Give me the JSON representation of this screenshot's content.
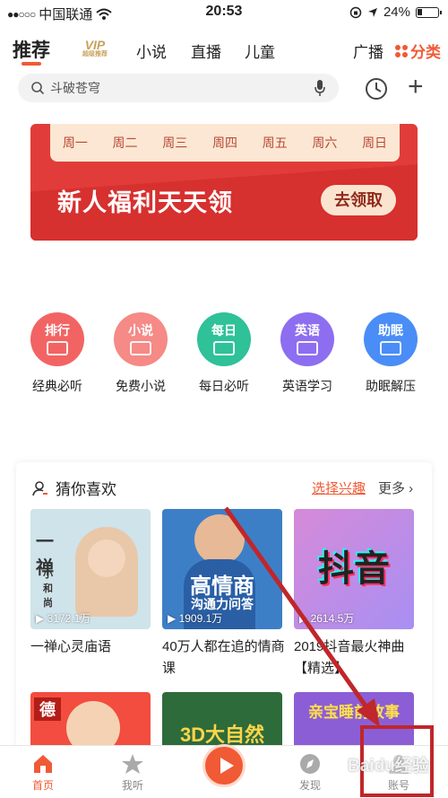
{
  "status_bar": {
    "carrier": "中国联通",
    "time": "20:53",
    "battery": "24%"
  },
  "nav": {
    "tabs": [
      "推荐",
      "小说",
      "直播",
      "儿童",
      "广播"
    ],
    "vip_label": "VIP",
    "vip_sub": "超级推荐",
    "category_label": "分类"
  },
  "search": {
    "placeholder": "斗破苍穹"
  },
  "banner": {
    "weekdays": [
      "周一",
      "周二",
      "周三",
      "周四",
      "周五",
      "周六",
      "周日"
    ],
    "title": "新人福利天天领",
    "button": "去领取"
  },
  "categories": [
    {
      "icon_text": "排行",
      "label": "经典必听",
      "color": "#f26463",
      "icon": "ranking-icon"
    },
    {
      "icon_text": "小说",
      "label": "免费小说",
      "color": "#f58a87",
      "icon": "novel-icon"
    },
    {
      "icon_text": "每日",
      "label": "每日必听",
      "color": "#2fc198",
      "icon": "calendar-icon"
    },
    {
      "icon_text": "英语",
      "label": "英语学习",
      "color": "#8d6ef0",
      "icon": "english-icon"
    },
    {
      "icon_text": "助眠",
      "label": "助眠解压",
      "color": "#4a8df6",
      "icon": "sleep-icon"
    }
  ],
  "guess": {
    "title": "猜你喜欢",
    "pick_label": "选择兴趣",
    "more_label": "更多",
    "items": [
      {
        "plays": "3172.1万",
        "caption": "一禅心灵庙语",
        "art_text": "一禅",
        "art_sub": "小和尚"
      },
      {
        "plays": "1909.1万",
        "caption": "40万人都在追的情商课",
        "art_text": "高情商",
        "art_sub": "沟通力问答"
      },
      {
        "plays": "2614.5万",
        "caption": "2019抖音最火神曲【精选】",
        "art_text": "抖音",
        "art_sub": ""
      }
    ],
    "second_row": [
      {
        "art_text": "德"
      },
      {
        "art_text": "3D大自然"
      },
      {
        "art_text": "亲宝睡前故事"
      }
    ]
  },
  "tabbar": {
    "items": [
      "首页",
      "我听",
      "",
      "发现",
      "账号"
    ]
  },
  "watermark": "Baidu经验"
}
